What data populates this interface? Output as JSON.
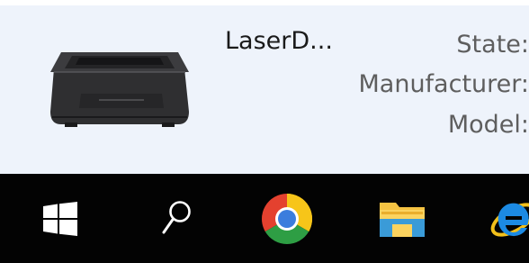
{
  "details": {
    "device_name": "LaserD...",
    "properties": {
      "state_label": "State:",
      "manufacturer_label": "Manufacturer:",
      "model_label": "Model:"
    },
    "thumbnail_icon": "printer-icon"
  },
  "taskbar": {
    "items": [
      {
        "icon": "windows-start-icon"
      },
      {
        "icon": "search-icon"
      },
      {
        "icon": "chrome-icon"
      },
      {
        "icon": "file-explorer-icon"
      },
      {
        "icon": "internet-explorer-icon"
      }
    ]
  },
  "colors": {
    "pane_background": "#eef3fb",
    "taskbar_background": "#030303",
    "label_text": "#5e5e5e"
  }
}
